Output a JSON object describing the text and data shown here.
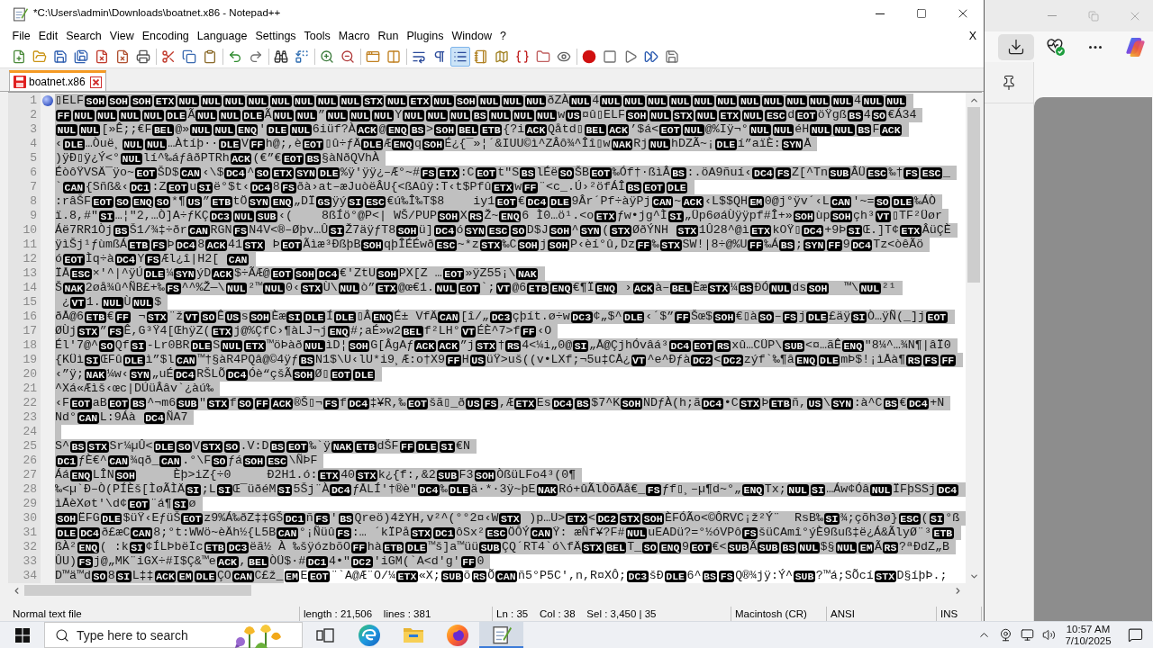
{
  "window": {
    "title": "*C:\\Users\\admin\\Downloads\\boatnet.x86 - Notepad++"
  },
  "menu": {
    "items": [
      "File",
      "Edit",
      "Search",
      "View",
      "Encoding",
      "Language",
      "Settings",
      "Tools",
      "Macro",
      "Run",
      "Plugins",
      "Window",
      "?"
    ],
    "close": "X"
  },
  "toolbar": [
    [
      {
        "kind": "new",
        "pressed": false
      },
      {
        "kind": "open",
        "pressed": false
      },
      {
        "kind": "save",
        "pressed": false
      },
      {
        "kind": "saveall",
        "pressed": false
      },
      {
        "kind": "close",
        "pressed": false
      },
      {
        "kind": "closeall",
        "pressed": false
      },
      {
        "kind": "print",
        "pressed": false
      }
    ],
    [
      {
        "kind": "cut",
        "pressed": false
      },
      {
        "kind": "copy",
        "pressed": false
      },
      {
        "kind": "paste",
        "pressed": false
      }
    ],
    [
      {
        "kind": "undo",
        "pressed": false
      },
      {
        "kind": "redo",
        "pressed": false
      }
    ],
    [
      {
        "kind": "find",
        "pressed": false
      },
      {
        "kind": "replace",
        "pressed": false
      }
    ],
    [
      {
        "kind": "zoomin",
        "pressed": false
      },
      {
        "kind": "zoomout",
        "pressed": false
      }
    ],
    [
      {
        "kind": "syncv",
        "pressed": false
      },
      {
        "kind": "synch",
        "pressed": false
      }
    ],
    [
      {
        "kind": "wrap",
        "pressed": false
      },
      {
        "kind": "allchars",
        "pressed": false
      },
      {
        "kind": "indent",
        "pressed": true
      },
      {
        "kind": "udl",
        "pressed": false
      },
      {
        "kind": "docmap",
        "pressed": false
      },
      {
        "kind": "funclist",
        "pressed": false
      },
      {
        "kind": "folderws",
        "pressed": false
      },
      {
        "kind": "monitor",
        "pressed": false
      }
    ],
    [
      {
        "kind": "record",
        "pressed": false
      },
      {
        "kind": "stop",
        "pressed": false
      },
      {
        "kind": "play",
        "pressed": false
      },
      {
        "kind": "playmulti",
        "pressed": false
      },
      {
        "kind": "savemacro",
        "pressed": false
      }
    ]
  ],
  "tabs": [
    {
      "label": "boatnet.x86",
      "selected": true,
      "modified": true
    }
  ],
  "editor": {
    "lines": [
      {
        "number": "1",
        "bookmark": true,
        "selected": true,
        "segments": [
          "▯ELF",
          {
            "ctrl": "SOH"
          },
          {
            "ctrl": "SOH"
          },
          {
            "ctrl": "SOH"
          },
          {
            "ctrl": "ETX"
          },
          {
            "ctrl": "NUL"
          },
          {
            "ctrl": "NUL"
          },
          {
            "ctrl": "NUL"
          },
          {
            "ctrl": "NUL"
          },
          {
            "ctrl": "NUL"
          },
          {
            "ctrl": "NUL"
          },
          {
            "ctrl": "NUL"
          },
          {
            "ctrl": "NUL"
          },
          {
            "ctrl": "STX"
          },
          {
            "ctrl": "NUL"
          },
          {
            "ctrl": "ETX"
          },
          {
            "ctrl": "NUL"
          },
          {
            "ctrl": "SOH"
          },
          {
            "ctrl": "NUL"
          },
          {
            "ctrl": "NUL"
          },
          {
            "ctrl": "NUL"
          },
          "ðZÀ",
          {
            "ctrl": "NUL"
          },
          "4",
          {
            "ctrl": "NUL"
          },
          {
            "ctrl": "NUL"
          },
          {
            "ctrl": "NUL"
          },
          {
            "ctrl": "NUL"
          },
          {
            "ctrl": "NUL"
          },
          {
            "ctrl": "NUL"
          },
          {
            "ctrl": "NUL"
          },
          {
            "ctrl": "NUL"
          },
          {
            "ctrl": "NUL"
          },
          {
            "ctrl": "NUL"
          },
          {
            "ctrl": "NUL"
          },
          "4",
          {
            "ctrl": "NUL"
          },
          {
            "ctrl": "NUL"
          }
        ]
      },
      {
        "number": "2",
        "bookmark": false,
        "selected": true,
        "segments": [
          {
            "ctrl": "FF"
          },
          {
            "ctrl": "NUL"
          },
          {
            "ctrl": "NUL"
          },
          {
            "ctrl": "NUL"
          },
          {
            "ctrl": "NUL"
          },
          {
            "ctrl": "DLE"
          },
          "Ã",
          {
            "ctrl": "NUL"
          },
          {
            "ctrl": "NUL"
          },
          {
            "ctrl": "DLE"
          },
          "Ã",
          {
            "ctrl": "NUL"
          },
          {
            "ctrl": "NUL"
          },
          "”",
          {
            "ctrl": "NUL"
          },
          {
            "ctrl": "NUL"
          },
          {
            "ctrl": "NUL"
          },
          "Y",
          {
            "ctrl": "NUL"
          },
          {
            "ctrl": "NUL"
          },
          {
            "ctrl": "NUL"
          },
          {
            "ctrl": "BS"
          },
          {
            "ctrl": "NUL"
          },
          {
            "ctrl": "NUL"
          },
          {
            "ctrl": "NUL"
          },
          "w",
          {
            "ctrl": "US"
          },
          "¤û▯ELF",
          {
            "ctrl": "SOH"
          },
          {
            "ctrl": "NUL"
          },
          {
            "ctrl": "STX"
          },
          {
            "ctrl": "NUL"
          },
          {
            "ctrl": "ETX"
          },
          {
            "ctrl": "NUL"
          },
          {
            "ctrl": "ESC"
          },
          "d",
          {
            "ctrl": "EOT"
          },
          "öŸgß",
          {
            "ctrl": "BS"
          },
          "4",
          {
            "ctrl": "SO"
          },
          "€Á34"
        ]
      },
      {
        "number": "3",
        "bookmark": false,
        "selected": true,
        "segments": [
          {
            "ctrl": "NUL"
          },
          {
            "ctrl": "NUL"
          },
          "[»Ê;;€F",
          {
            "ctrl": "BEL"
          },
          "@»",
          {
            "ctrl": "NUL"
          },
          {
            "ctrl": "NUL"
          },
          {
            "ctrl": "ENQ"
          },
          "'",
          {
            "ctrl": "DLE"
          },
          {
            "ctrl": "NUL"
          },
          "6iüf?À",
          {
            "ctrl": "ACK"
          },
          "@",
          {
            "ctrl": "ENQ"
          },
          {
            "ctrl": "BS"
          },
          ">",
          {
            "ctrl": "SOH"
          },
          {
            "ctrl": "BEL"
          },
          {
            "ctrl": "ETB"
          },
          "{?i",
          {
            "ctrl": "ACK"
          },
          "Qåtd▯",
          {
            "ctrl": "BEL"
          },
          {
            "ctrl": "ACK"
          },
          "’$á<",
          {
            "ctrl": "EOT"
          },
          {
            "ctrl": "NUL"
          },
          "@%Iÿ¬°",
          {
            "ctrl": "NUL"
          },
          {
            "ctrl": "NUL"
          },
          "éH",
          {
            "ctrl": "NUL"
          },
          {
            "ctrl": "NUL"
          },
          {
            "ctrl": "BS"
          },
          "F",
          {
            "ctrl": "ACK"
          }
        ]
      },
      {
        "number": "4",
        "bookmark": false,
        "selected": true,
        "segments": [
          "‹",
          {
            "ctrl": "DLE"
          },
          "…Òuë¸",
          {
            "ctrl": "NUL"
          },
          {
            "ctrl": "NUL"
          },
          "…Àtíþ··",
          {
            "ctrl": "DLE"
          },
          "V",
          {
            "ctrl": "FF"
          },
          "h@;,è",
          {
            "ctrl": "EOT"
          },
          "▯û÷ƒÄ",
          {
            "ctrl": "DLE"
          },
          "Æ",
          {
            "ctrl": "ENQ"
          },
          "q",
          {
            "ctrl": "SOH"
          },
          "É¿{¯»¦´&IUU©ì^ZÂô¾^Îî▯w",
          {
            "ctrl": "NAK"
          },
          "Rj",
          {
            "ctrl": "NUL"
          },
          "hDZÃ~¡",
          {
            "ctrl": "DLE"
          },
          "í”aïÈ:",
          {
            "ctrl": "SYN"
          },
          "Å"
        ]
      },
      {
        "number": "5",
        "bookmark": false,
        "selected": true,
        "segments": [
          ")ÿÐ▯ÿ¿Ý<°",
          {
            "ctrl": "NUL"
          },
          "lí^‰áƒâðPTRh",
          {
            "ctrl": "ACK"
          },
          "(€”€",
          {
            "ctrl": "EOT"
          },
          {
            "ctrl": "BS"
          },
          "§àNðQVhÀ"
        ]
      },
      {
        "number": "6",
        "bookmark": false,
        "selected": true,
        "segments": [
          "ÉòôŸVSÄ¯ÿo~",
          {
            "ctrl": "EOT"
          },
          "ŠD$",
          {
            "ctrl": "CAN"
          },
          "‹\\$",
          {
            "ctrl": "DC4"
          },
          "^",
          {
            "ctrl": "SO"
          },
          {
            "ctrl": "ETX"
          },
          {
            "ctrl": "SYN"
          },
          {
            "ctrl": "DLE"
          },
          "%ÿ'ÿÿ¿–Æ°~#",
          {
            "ctrl": "FS"
          },
          {
            "ctrl": "ETX"
          },
          ":C",
          {
            "ctrl": "EOT"
          },
          "t\"S",
          {
            "ctrl": "BS"
          },
          "lÉë",
          {
            "ctrl": "SO"
          },
          "ŠB",
          {
            "ctrl": "EOT"
          },
          "‰Óf†·ßìÂ",
          {
            "ctrl": "BS"
          },
          ":.öA9ñuí‹",
          {
            "ctrl": "DC4"
          },
          {
            "ctrl": "FS"
          },
          "Z[^Tn",
          {
            "ctrl": "SUB"
          },
          "ÂÜ",
          {
            "ctrl": "ESC"
          },
          "‰†",
          {
            "ctrl": "FS"
          },
          {
            "ctrl": "ESC"
          },
          "_"
        ]
      },
      {
        "number": "7",
        "bookmark": false,
        "selected": true,
        "segments": [
          "`",
          {
            "ctrl": "CAN"
          },
          "{Sñß&‹",
          {
            "ctrl": "DC1"
          },
          ":Z",
          {
            "ctrl": "EOT"
          },
          "u",
          {
            "ctrl": "SI"
          },
          "ë°$t‹",
          {
            "ctrl": "DC4"
          },
          "8",
          {
            "ctrl": "FS"
          },
          "ðà›at–æJuòëÂU{<ßAûÿ:T‹t$Pfû",
          {
            "ctrl": "ETX"
          },
          "w",
          {
            "ctrl": "FF"
          },
          "¨<c_.Ú›²öfÁÎ",
          {
            "ctrl": "BS"
          },
          {
            "ctrl": "EOT"
          },
          {
            "ctrl": "DLE"
          }
        ]
      },
      {
        "number": "8",
        "bookmark": false,
        "selected": true,
        "segments": [
          ":râŠF",
          {
            "ctrl": "EOT"
          },
          {
            "ctrl": "SO"
          },
          {
            "ctrl": "ENQ"
          },
          {
            "ctrl": "SO"
          },
          "*¶",
          {
            "ctrl": "US"
          },
          "”",
          {
            "ctrl": "ETB"
          },
          "tÖ",
          {
            "ctrl": "SYN"
          },
          {
            "ctrl": "ENQ"
          },
          "„DÏ",
          {
            "ctrl": "GS"
          },
          "ÿý",
          {
            "ctrl": "SI"
          },
          {
            "ctrl": "ESC"
          },
          "€ú‰Î‰T$8    iy1",
          {
            "ctrl": "EOT"
          },
          "€",
          {
            "ctrl": "DC4"
          },
          {
            "ctrl": "DLE"
          },
          "9Âr´Pf÷àÿPj",
          {
            "ctrl": "CAN"
          },
          "~",
          {
            "ctrl": "ACK"
          },
          "‹L$$QH",
          {
            "ctrl": "EM"
          },
          "0@j°ÿv´‹L",
          {
            "ctrl": "CAN"
          },
          "′~=",
          {
            "ctrl": "SO"
          },
          {
            "ctrl": "DLE"
          },
          "‰ÁÒ"
        ]
      },
      {
        "number": "9",
        "bookmark": false,
        "selected": true,
        "segments": [
          "ï.8,#\"",
          {
            "ctrl": "SI"
          },
          "…¦\"2,…Ò]A÷ƒKÇ",
          {
            "ctrl": "DC3"
          },
          {
            "ctrl": "NUL"
          },
          {
            "ctrl": "SUB"
          },
          "‹(    8ßÍö°@P<| WŠ/PUP",
          {
            "ctrl": "SOH"
          },
          "X",
          {
            "ctrl": "RS"
          },
          "Ž~",
          {
            "ctrl": "ENQ"
          },
          "6 Ì0…ö¹.<o",
          {
            "ctrl": "ETX"
          },
          "ƒw•jg^Ì",
          {
            "ctrl": "SI"
          },
          "„Üp6øáÙÿÿpf#Î+»",
          {
            "ctrl": "SOH"
          },
          "ùp",
          {
            "ctrl": "SOH"
          },
          "çh³",
          {
            "ctrl": "VT"
          },
          "▯TF²Üør"
        ]
      },
      {
        "number": "10",
        "bookmark": false,
        "selected": true,
        "segments": [
          "Áë7RR1Òj",
          {
            "ctrl": "BS"
          },
          "Š1/¾‡÷ðr",
          {
            "ctrl": "CAN"
          },
          "RGN",
          {
            "ctrl": "FS"
          },
          "N4V<®–Øþv…Û",
          {
            "ctrl": "SI"
          },
          "Ž7äÿƒT8",
          {
            "ctrl": "SOH"
          },
          "ü]",
          {
            "ctrl": "DC4"
          },
          "ó",
          {
            "ctrl": "SYN"
          },
          {
            "ctrl": "ESC"
          },
          {
            "ctrl": "SO"
          },
          "D$J",
          {
            "ctrl": "SOH"
          },
          "^",
          {
            "ctrl": "SYN"
          },
          "(",
          {
            "ctrl": "STX"
          },
          "ØðÝNH ",
          {
            "ctrl": "STX"
          },
          "1Û28^@ì",
          {
            "ctrl": "ETX"
          },
          "kOŸ▯",
          {
            "ctrl": "DC4"
          },
          "+9Þ",
          {
            "ctrl": "SI"
          },
          "Œ.]T¢",
          {
            "ctrl": "ETX"
          },
          "ÂüÇÈ"
        ]
      },
      {
        "number": "11",
        "bookmark": false,
        "selected": true,
        "segments": [
          "ÿìŠj¹ƒùmßÁ",
          {
            "ctrl": "ETB"
          },
          {
            "ctrl": "FS"
          },
          "Þ",
          {
            "ctrl": "DC4"
          },
          "8",
          {
            "ctrl": "ACK"
          },
          "41",
          {
            "ctrl": "STX"
          },
          " Þ",
          {
            "ctrl": "EOT"
          },
          "Ãìæ³ÐßþB",
          {
            "ctrl": "SOH"
          },
          "qþÎÉÉwð",
          {
            "ctrl": "ESC"
          },
          "~*z",
          {
            "ctrl": "STX"
          },
          "‰C",
          {
            "ctrl": "SOH"
          },
          "j",
          {
            "ctrl": "SOH"
          },
          "P‹èí°û,Dz",
          {
            "ctrl": "FF"
          },
          "‰",
          {
            "ctrl": "STX"
          },
          "SW!|8÷@%U",
          {
            "ctrl": "FF"
          },
          "‰Á",
          {
            "ctrl": "BS"
          },
          ";",
          {
            "ctrl": "SYN"
          },
          {
            "ctrl": "FF"
          },
          "9",
          {
            "ctrl": "DC4"
          },
          "Tz<òêÃö"
        ]
      },
      {
        "number": "12",
        "bookmark": false,
        "selected": true,
        "segments": [
          "ó",
          {
            "ctrl": "EOT"
          },
          "Ìq÷à",
          {
            "ctrl": "DC4"
          },
          "Y",
          {
            "ctrl": "FS"
          },
          "Æl¿î|H2[ ",
          {
            "ctrl": "CAN"
          }
        ]
      },
      {
        "number": "13",
        "bookmark": false,
        "selected": true,
        "segments": [
          "ÏÅ",
          {
            "ctrl": "ESC"
          },
          "×'^|^ÿÚ",
          {
            "ctrl": "DLE"
          },
          "¼",
          {
            "ctrl": "SYN"
          },
          "ýD",
          {
            "ctrl": "ACK"
          },
          "$÷ÃÆ@",
          {
            "ctrl": "EOT"
          },
          {
            "ctrl": "SOH"
          },
          {
            "ctrl": "DC4"
          },
          "€'ZtU",
          {
            "ctrl": "SOH"
          },
          "PX[Z …",
          {
            "ctrl": "EOT"
          },
          "»ÿZ55¡\\",
          {
            "ctrl": "NAK"
          }
        ]
      },
      {
        "number": "14",
        "bookmark": false,
        "selected": true,
        "segments": [
          "Š",
          {
            "ctrl": "NAK"
          },
          "2øå¾û^ÑB£+‰",
          {
            "ctrl": "FS"
          },
          "^^%Ž—\\",
          {
            "ctrl": "NUL"
          },
          "²™",
          {
            "ctrl": "NUL"
          },
          "0‹",
          {
            "ctrl": "STX"
          },
          "Ù\\",
          {
            "ctrl": "NUL"
          },
          "ò”",
          {
            "ctrl": "ETX"
          },
          "@œ€1.",
          {
            "ctrl": "NUL"
          },
          {
            "ctrl": "EOT"
          },
          "`;",
          {
            "ctrl": "VT"
          },
          "@6",
          {
            "ctrl": "ETB"
          },
          {
            "ctrl": "ENQ"
          },
          "€¶Ï",
          {
            "ctrl": "ENQ"
          },
          " ›",
          {
            "ctrl": "ACK"
          },
          "à–",
          {
            "ctrl": "BEL"
          },
          "Èæ",
          {
            "ctrl": "STX"
          },
          "¼",
          {
            "ctrl": "BS"
          },
          "ÐÓ",
          {
            "ctrl": "NUL"
          },
          "ds",
          {
            "ctrl": "SOH"
          },
          "  ™\\",
          {
            "ctrl": "NUL"
          },
          "²¹"
        ]
      },
      {
        "number": "15",
        "bookmark": false,
        "selected": true,
        "segments": [
          " ¿",
          {
            "ctrl": "VT"
          },
          "1.",
          {
            "ctrl": "NUL"
          },
          "Ù",
          {
            "ctrl": "NUL"
          },
          "$"
        ]
      },
      {
        "number": "16",
        "bookmark": false,
        "selected": true,
        "segments": [
          "ðÅ@6",
          {
            "ctrl": "ETB"
          },
          "€",
          {
            "ctrl": "FF"
          },
          " ¬",
          {
            "ctrl": "STX"
          },
          "¨ž",
          {
            "ctrl": "VT"
          },
          {
            "ctrl": "SO"
          },
          "Ê",
          {
            "ctrl": "US"
          },
          "s",
          {
            "ctrl": "SOH"
          },
          "Èæ",
          {
            "ctrl": "SI"
          },
          {
            "ctrl": "DLE"
          },
          "Í",
          {
            "ctrl": "DLE"
          },
          "▯Â",
          {
            "ctrl": "ENQ"
          },
          "É± VfÄ",
          {
            "ctrl": "CAN"
          },
          "[î/„",
          {
            "ctrl": "DC3"
          },
          "çþít.ø÷w",
          {
            "ctrl": "DC3"
          },
          "¢„$^",
          {
            "ctrl": "DLE"
          },
          "‹´$”",
          {
            "ctrl": "FF"
          },
          "Šœ$",
          {
            "ctrl": "SOH"
          },
          "€▯à",
          {
            "ctrl": "SO"
          },
          "–",
          {
            "ctrl": "FS"
          },
          "j",
          {
            "ctrl": "DLE"
          },
          "£äÿ",
          {
            "ctrl": "SI"
          },
          "Ò…ÿÑ(_]j",
          {
            "ctrl": "EOT"
          }
        ]
      },
      {
        "number": "17",
        "bookmark": false,
        "selected": true,
        "segments": [
          "ØÙj",
          {
            "ctrl": "STX"
          },
          "”",
          {
            "ctrl": "FS"
          },
          "Ê,G³Ÿ4[ŒhÿZ(",
          {
            "ctrl": "ETX"
          },
          "j@%ÇfC›¶àLJ¬j",
          {
            "ctrl": "ENQ"
          },
          "#;aÉ»w2",
          {
            "ctrl": "BEL"
          },
          "f²LH°",
          {
            "ctrl": "VT"
          },
          "ÉÈ^7>f",
          {
            "ctrl": "FF"
          },
          "‹O"
        ]
      },
      {
        "number": "18",
        "bookmark": false,
        "selected": true,
        "segments": [
          "Él'7@^",
          {
            "ctrl": "SO"
          },
          "Qf",
          {
            "ctrl": "SI"
          },
          "-Lr0BR",
          {
            "ctrl": "DLE"
          },
          "S",
          {
            "ctrl": "NUL"
          },
          {
            "ctrl": "ETX"
          },
          "™öÞàð",
          {
            "ctrl": "NUL"
          },
          "ìD¦",
          {
            "ctrl": "SOH"
          },
          "G[ÂgAƒ",
          {
            "ctrl": "ACK"
          },
          {
            "ctrl": "ACK"
          },
          "”j",
          {
            "ctrl": "STX"
          },
          "†",
          {
            "ctrl": "RS"
          },
          "4<¼i„0@",
          {
            "ctrl": "SI"
          },
          "„Å@ÇjhÓvâá³",
          {
            "ctrl": "DC4"
          },
          {
            "ctrl": "EOT"
          },
          {
            "ctrl": "RS"
          },
          "xû…CÜP\\",
          {
            "ctrl": "SUB"
          },
          "<¤…ãÊ",
          {
            "ctrl": "ENQ"
          },
          "\"8¼^…¾N¶|âÏ0"
        ]
      },
      {
        "number": "19",
        "bookmark": false,
        "selected": true,
        "segments": [
          "{KÜì",
          {
            "ctrl": "SI"
          },
          "ŒFû",
          {
            "ctrl": "DLE"
          },
          "ì”$l",
          {
            "ctrl": "CAN"
          },
          "™†§àR4PQâ@©4ÿƒ",
          {
            "ctrl": "BS"
          },
          "N1$\\U‹lU*i9¸Æ:o†X9",
          {
            "ctrl": "FF"
          },
          "H",
          {
            "ctrl": "US"
          },
          "üŸ>uš((v•LXf;¬5u‡CÅ¿",
          {
            "ctrl": "VT"
          },
          "^e^Ðƒà",
          {
            "ctrl": "DC2"
          },
          "<",
          {
            "ctrl": "DC2"
          },
          "zýf`‰¶â",
          {
            "ctrl": "ENQ"
          },
          {
            "ctrl": "DLE"
          },
          "mÞ$!¡ìÅà¶",
          {
            "ctrl": "RS"
          },
          {
            "ctrl": "FS"
          },
          {
            "ctrl": "FF"
          }
        ]
      },
      {
        "number": "20",
        "bookmark": false,
        "selected": true,
        "segments": [
          "‹”ÿ;",
          {
            "ctrl": "NAK"
          },
          "¼w‹",
          {
            "ctrl": "SYN"
          },
          "„uÉ",
          {
            "ctrl": "DC4"
          },
          "RŠLÕ",
          {
            "ctrl": "DC4"
          },
          "Óè“çšÃ",
          {
            "ctrl": "SOH"
          },
          "Ø▯",
          {
            "ctrl": "EOT"
          },
          {
            "ctrl": "DLE"
          }
        ]
      },
      {
        "number": "21",
        "bookmark": false,
        "selected": true,
        "segments": [
          "^Xá«Æìš‹œc|DÚüÂâv`¿àú‰"
        ]
      },
      {
        "number": "22",
        "bookmark": false,
        "selected": true,
        "segments": [
          "‹F",
          {
            "ctrl": "EOT"
          },
          "aB",
          {
            "ctrl": "EOT"
          },
          {
            "ctrl": "BS"
          },
          "^¬m6",
          {
            "ctrl": "SUB"
          },
          "\"",
          {
            "ctrl": "STX"
          },
          "f",
          {
            "ctrl": "SO"
          },
          {
            "ctrl": "FF"
          },
          {
            "ctrl": "ACK"
          },
          "®Š▯¬",
          {
            "ctrl": "FS"
          },
          "f",
          {
            "ctrl": "DC4"
          },
          "‡¥R,‰",
          {
            "ctrl": "EOT"
          },
          "šã▯_ð",
          {
            "ctrl": "US"
          },
          {
            "ctrl": "FS"
          },
          ",Æ",
          {
            "ctrl": "ETX"
          },
          "Es",
          {
            "ctrl": "DC4"
          },
          {
            "ctrl": "BS"
          },
          "$7^K",
          {
            "ctrl": "SOH"
          },
          "NDƒÀ(h;ã",
          {
            "ctrl": "DC4"
          },
          "•C",
          {
            "ctrl": "STX"
          },
          "Þ",
          {
            "ctrl": "ETB"
          },
          "ñ,",
          {
            "ctrl": "US"
          },
          "\\",
          {
            "ctrl": "SYN"
          },
          ":à^C",
          {
            "ctrl": "BS"
          },
          "€",
          {
            "ctrl": "DC4"
          },
          "+N"
        ]
      },
      {
        "number": "23",
        "bookmark": false,
        "selected": true,
        "segments": [
          "Nd°",
          {
            "ctrl": "CAN"
          },
          "L:9Áà ",
          {
            "ctrl": "DC4"
          },
          "ÑA7"
        ]
      },
      {
        "number": "24",
        "bookmark": false,
        "selected": true
      },
      {
        "number": "25",
        "bookmark": false,
        "selected": true,
        "segments": [
          "S^",
          {
            "ctrl": "BS"
          },
          {
            "ctrl": "STX"
          },
          "Sr¼µÛ<",
          {
            "ctrl": "DLE"
          },
          {
            "ctrl": "SO"
          },
          "V",
          {
            "ctrl": "STX"
          },
          {
            "ctrl": "SO"
          },
          ".V:D",
          {
            "ctrl": "BS"
          },
          {
            "ctrl": "EOT"
          },
          "‰`ÿ",
          {
            "ctrl": "NAK"
          },
          {
            "ctrl": "ETB"
          },
          "dŠF",
          {
            "ctrl": "FF"
          },
          {
            "ctrl": "DLE"
          },
          {
            "ctrl": "SI"
          },
          "€N"
        ]
      },
      {
        "number": "26",
        "bookmark": false,
        "selected": true,
        "segments": [
          {
            "ctrl": "DC1"
          },
          "ƒÈ€^",
          {
            "ctrl": "CAN"
          },
          "¾qð_",
          {
            "ctrl": "CAN"
          },
          ".°\\F",
          {
            "ctrl": "SO"
          },
          "ƒá",
          {
            "ctrl": "SOH"
          },
          {
            "ctrl": "ESC"
          },
          "\\ÑÞF"
        ]
      },
      {
        "number": "27",
        "bookmark": false,
        "selected": true,
        "segments": [
          "Áá",
          {
            "ctrl": "ENQ"
          },
          "LÎN",
          {
            "ctrl": "SOH"
          },
          "     Èþ>iZ{÷0     Ð2H1.ó:",
          {
            "ctrl": "ETX"
          },
          "40",
          {
            "ctrl": "STX"
          },
          "k¿{f:,&2",
          {
            "ctrl": "SUB"
          },
          "F3",
          {
            "ctrl": "SOH"
          },
          "ÒßüLFo4³(0¶"
        ]
      },
      {
        "number": "28",
        "bookmark": false,
        "selected": true,
        "segments": [
          "‰<µ`Ð–Ò(PÍÈš[ÌøÃÌÄ",
          {
            "ctrl": "SI"
          },
          ";L",
          {
            "ctrl": "SI"
          },
          "Œ¯üðéM",
          {
            "ctrl": "SI"
          },
          "5Šj¨À",
          {
            "ctrl": "DC4"
          },
          "ƒÅLÍ'†®è\"",
          {
            "ctrl": "DC4"
          },
          "‰",
          {
            "ctrl": "DLE"
          },
          "ä·*·3ÿ~þE",
          {
            "ctrl": "NAK"
          },
          "Ró+ûÃlÒõÅå€_",
          {
            "ctrl": "FS"
          },
          "ƒf▯¸–µ¶d~°„",
          {
            "ctrl": "ENQ"
          },
          "Tx;",
          {
            "ctrl": "NUL"
          },
          {
            "ctrl": "SI"
          },
          "…Áw¢Óâ",
          {
            "ctrl": "NUL"
          },
          "ÏFþSSj",
          {
            "ctrl": "DC4"
          }
        ]
      },
      {
        "number": "29",
        "bookmark": false,
        "selected": true,
        "segments": [
          "ìÅèXøt'\\d¢",
          {
            "ctrl": "EOT"
          },
          "¨á¶",
          {
            "ctrl": "SI"
          },
          "ø"
        ]
      },
      {
        "number": "30",
        "bookmark": false,
        "selected": true,
        "segments": [
          {
            "ctrl": "SOH"
          },
          "ËFG",
          {
            "ctrl": "DLE"
          },
          "$üŸ‹EƒüŠ",
          {
            "ctrl": "EOT"
          },
          "z9%Á‰ðZ‡‡GŠ",
          {
            "ctrl": "DC1"
          },
          "ñ",
          {
            "ctrl": "FS"
          },
          "'",
          {
            "ctrl": "BS"
          },
          "Qreö)4žYH,v²^(°°2¤‹W",
          {
            "ctrl": "STX"
          },
          " )p…U>",
          {
            "ctrl": "ETX"
          },
          "<",
          {
            "ctrl": "DC2"
          },
          {
            "ctrl": "STX"
          },
          {
            "ctrl": "SOH"
          },
          "ÈFÓÃo<©ÔRVC¡ž²Ý¨  RsB‰",
          {
            "ctrl": "SI"
          },
          "¾;çõh3ø}",
          {
            "ctrl": "ESC"
          },
          "(",
          {
            "ctrl": "SI"
          },
          "°ß"
        ]
      },
      {
        "number": "31",
        "bookmark": false,
        "selected": true,
        "segments": [
          {
            "ctrl": "DLE"
          },
          {
            "ctrl": "DC4"
          },
          "ð£æC",
          {
            "ctrl": "CAN"
          },
          "8;°t:WWö~èÄh½{L5B",
          {
            "ctrl": "CAN"
          },
          "°¡Ñüû",
          {
            "ctrl": "FS"
          },
          ":… ´kÏPå",
          {
            "ctrl": "STX"
          },
          {
            "ctrl": "DC1"
          },
          "ôSx²",
          {
            "ctrl": "ESC"
          },
          "ÖÔÝ",
          {
            "ctrl": "CAN"
          },
          "Ÿ: æÑf¥?F#",
          {
            "ctrl": "NUL"
          },
          "uEADü?=°½óVPô",
          {
            "ctrl": "FS"
          },
          "šüCAmî°ýÈ9ßuß‡ë¿Á&ÃlyØ¨³",
          {
            "ctrl": "ETB"
          }
        ]
      },
      {
        "number": "32",
        "bookmark": false,
        "selected": true,
        "segments": [
          "ßÀ²",
          {
            "ctrl": "ENQ"
          },
          "( :k",
          {
            "ctrl": "SI"
          },
          "¢ÍLÞbëÏc",
          {
            "ctrl": "ETB"
          },
          {
            "ctrl": "DC3"
          },
          "ëã½ À ‰šÿózbõO",
          {
            "ctrl": "FF"
          },
          "hà",
          {
            "ctrl": "ETB"
          },
          {
            "ctrl": "DLE"
          },
          "™š]a™üü",
          {
            "ctrl": "SUB"
          },
          "ÇQ´RT4`ó\\fÄ",
          {
            "ctrl": "STX"
          },
          {
            "ctrl": "BEL"
          },
          "T_",
          {
            "ctrl": "SO"
          },
          {
            "ctrl": "ENQ"
          },
          "9",
          {
            "ctrl": "EOT"
          },
          "€<",
          {
            "ctrl": "SUB"
          },
          "Ã",
          {
            "ctrl": "SUB"
          },
          {
            "ctrl": "BS"
          },
          {
            "ctrl": "NUL"
          },
          "$§",
          {
            "ctrl": "NUL"
          },
          {
            "ctrl": "EM"
          },
          "Ã",
          {
            "ctrl": "RS"
          },
          "?ªÐdZ„B"
        ]
      },
      {
        "number": "33",
        "bookmark": false,
        "selected": true,
        "segments": [
          "ÛU)",
          {
            "ctrl": "FS"
          },
          "j@„MK¨iGX÷#I$Ç&™e",
          {
            "ctrl": "ACK"
          },
          ",",
          {
            "ctrl": "BEL"
          },
          "ÒÜ$·#",
          {
            "ctrl": "DC1"
          },
          "4•\"",
          {
            "ctrl": "DC2"
          },
          "'iGM(`A<d'g'",
          {
            "ctrl": "FF"
          },
          "0"
        ]
      },
      {
        "number": "34",
        "bookmark": false,
        "selected": true,
        "segments": [
          "D™ä™d",
          {
            "ctrl": "SO"
          },
          "8",
          {
            "ctrl": "SI"
          },
          "L‡‡",
          {
            "ctrl": "ACK"
          },
          {
            "ctrl": "EM"
          },
          {
            "ctrl": "DLE"
          },
          "ÇO",
          {
            "ctrl": "CAN"
          },
          "C£ž_"
        ],
        "unselected_segments": [
          {
            "ctrl": "EM"
          },
          "E",
          {
            "ctrl": "EOT"
          },
          "¨`A@Æ¨O/¼",
          {
            "ctrl": "ETX"
          },
          "«X;",
          {
            "ctrl": "SUB"
          },
          "õ",
          {
            "ctrl": "RS"
          },
          "Õ",
          {
            "ctrl": "CAN"
          },
          "ñ5°P5C',n,R¤XÔ;",
          {
            "ctrl": "DC3"
          },
          "šÐ",
          {
            "ctrl": "DLE"
          },
          "6^",
          {
            "ctrl": "BS"
          },
          {
            "ctrl": "FS"
          },
          "Q®¾jÿ:Ý^",
          {
            "ctrl": "SUB"
          },
          "?™á;SÕcí",
          {
            "ctrl": "STX"
          },
          "D§íþÞ.;"
        ]
      }
    ]
  },
  "status_bar": [
    "Normal text file",
    "length : 21,506    lines : 381",
    "Ln : 35    Col : 38    Sel : 3,450 | 35",
    "Macintosh (CR)",
    "ANSI",
    "INS"
  ],
  "browser": {
    "toolbar": [
      {
        "kind": "downloads",
        "selected": true
      },
      {
        "kind": "health",
        "selected": false
      },
      {
        "kind": "more",
        "selected": false
      },
      {
        "kind": "copilot",
        "selected": false
      }
    ]
  },
  "taskbar": {
    "search": {
      "placeholder": "Type here to search"
    },
    "apps": [
      {
        "kind": "taskview",
        "selected": false
      },
      {
        "kind": "edge",
        "selected": false
      },
      {
        "kind": "explorer",
        "selected": false
      },
      {
        "kind": "firefox",
        "selected": false
      },
      {
        "kind": "notepad",
        "selected": true
      }
    ],
    "time": "10:57 AM",
    "date": "7/10/2025"
  }
}
